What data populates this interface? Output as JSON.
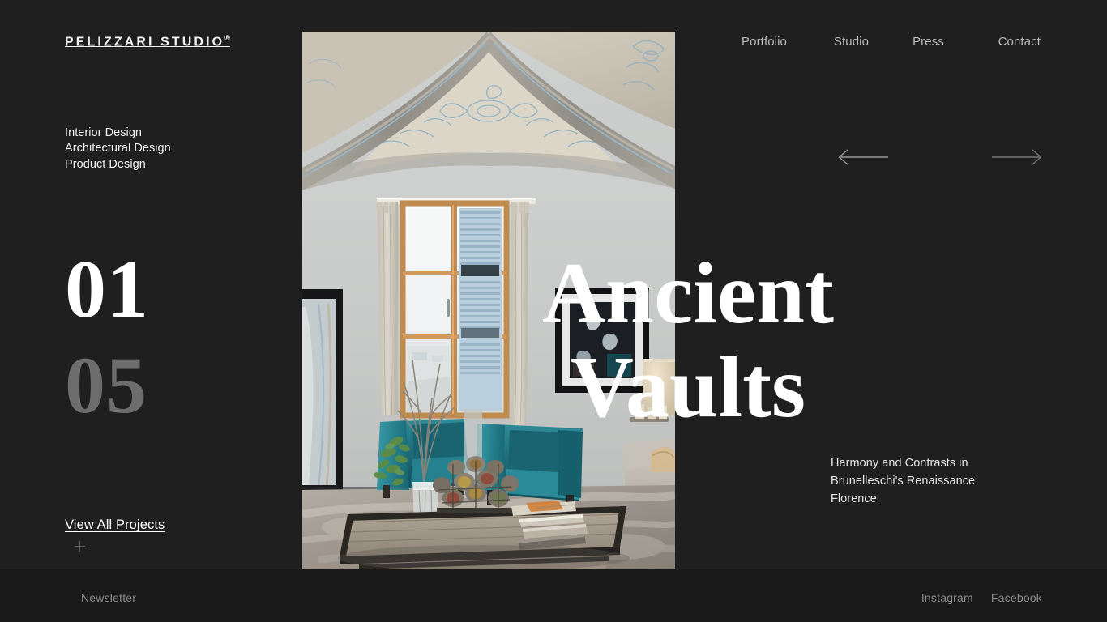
{
  "brand": {
    "name": "PELIZZARI STUDIO",
    "registered_mark": "®"
  },
  "nav": {
    "items": [
      {
        "label": "Portfolio"
      },
      {
        "label": "Studio"
      },
      {
        "label": "Press"
      },
      {
        "label": "Contact"
      }
    ]
  },
  "services": {
    "line1": "Interior Design",
    "line2": "Architectural Design",
    "line3": "Product Design"
  },
  "slider": {
    "current": "01",
    "total": "05",
    "prev_label": "Previous project",
    "next_label": "Next project"
  },
  "project": {
    "title_line1": "Ancient",
    "title_line2": "Vaults",
    "description": "Harmony and Contrasts in Brunelleschi's Renaissance Florence",
    "image_alt": "Renaissance vaulted living room with teal armchairs and wooden coffee table"
  },
  "cta": {
    "view_all": "View All Projects",
    "plus_icon": "plus-icon"
  },
  "footer": {
    "newsletter": "Newsletter",
    "social": [
      {
        "label": "Instagram"
      },
      {
        "label": "Facebook"
      }
    ]
  },
  "colors": {
    "background": "#1f1f1f",
    "footer_background": "#1a1a1a",
    "text_primary": "#ffffff",
    "text_muted": "#8a8a8a",
    "counter_total": "#6d6d6d",
    "nav_link": "#b9b9b9"
  }
}
